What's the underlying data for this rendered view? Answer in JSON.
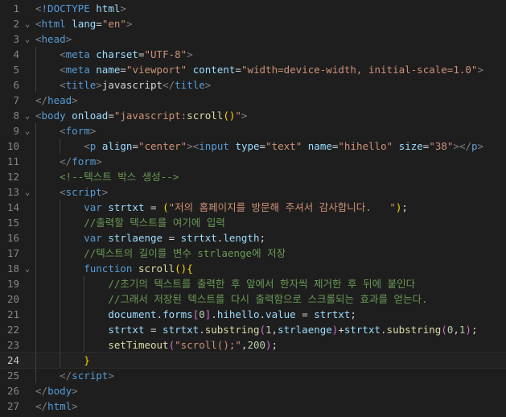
{
  "editor": {
    "theme": {
      "background": "#1e1e1e",
      "tag": "#569cd6",
      "attribute": "#9cdcfe",
      "string": "#ce9178",
      "comment": "#6a9955",
      "function": "#dcdcaa",
      "number": "#b5cea8"
    },
    "current_line": 24,
    "lines": [
      {
        "n": "1",
        "fold": "",
        "guides": 0,
        "tokens": [
          [
            "t-punct",
            "<"
          ],
          [
            "t-tag",
            "!DOCTYPE"
          ],
          [
            "t-txt",
            " "
          ],
          [
            "t-attr",
            "html"
          ],
          [
            "t-punct",
            ">"
          ]
        ]
      },
      {
        "n": "2",
        "fold": "⌄",
        "guides": 0,
        "tokens": [
          [
            "t-punct",
            "<"
          ],
          [
            "t-tag",
            "html"
          ],
          [
            "t-txt",
            " "
          ],
          [
            "t-attr",
            "lang"
          ],
          [
            "t-txt",
            "="
          ],
          [
            "t-str",
            "\"en\""
          ],
          [
            "t-punct",
            ">"
          ]
        ]
      },
      {
        "n": "3",
        "fold": "⌄",
        "guides": 0,
        "tokens": [
          [
            "t-punct",
            "<"
          ],
          [
            "t-tag",
            "head"
          ],
          [
            "t-punct",
            ">"
          ]
        ]
      },
      {
        "n": "4",
        "fold": "",
        "guides": 1,
        "tokens": [
          [
            "t-txt",
            "    "
          ],
          [
            "t-punct",
            "<"
          ],
          [
            "t-tag",
            "meta"
          ],
          [
            "t-txt",
            " "
          ],
          [
            "t-attr",
            "charset"
          ],
          [
            "t-txt",
            "="
          ],
          [
            "t-str",
            "\"UTF-8\""
          ],
          [
            "t-punct",
            ">"
          ]
        ]
      },
      {
        "n": "5",
        "fold": "",
        "guides": 1,
        "tokens": [
          [
            "t-txt",
            "    "
          ],
          [
            "t-punct",
            "<"
          ],
          [
            "t-tag",
            "meta"
          ],
          [
            "t-txt",
            " "
          ],
          [
            "t-attr",
            "name"
          ],
          [
            "t-txt",
            "="
          ],
          [
            "t-str",
            "\"viewport\""
          ],
          [
            "t-txt",
            " "
          ],
          [
            "t-attr",
            "content"
          ],
          [
            "t-txt",
            "="
          ],
          [
            "t-str",
            "\"width=device-width, initial-scale=1.0\""
          ],
          [
            "t-punct",
            ">"
          ]
        ]
      },
      {
        "n": "6",
        "fold": "",
        "guides": 1,
        "tokens": [
          [
            "t-txt",
            "    "
          ],
          [
            "t-punct",
            "<"
          ],
          [
            "t-tag",
            "title"
          ],
          [
            "t-punct",
            ">"
          ],
          [
            "t-txt",
            "javascript"
          ],
          [
            "t-punct",
            "</"
          ],
          [
            "t-tag",
            "title"
          ],
          [
            "t-punct",
            ">"
          ]
        ]
      },
      {
        "n": "7",
        "fold": "",
        "guides": 0,
        "tokens": [
          [
            "t-punct",
            "</"
          ],
          [
            "t-tag",
            "head"
          ],
          [
            "t-punct",
            ">"
          ]
        ]
      },
      {
        "n": "8",
        "fold": "⌄",
        "guides": 0,
        "tokens": [
          [
            "t-punct",
            "<"
          ],
          [
            "t-tag",
            "body"
          ],
          [
            "t-txt",
            " "
          ],
          [
            "t-attr",
            "onload"
          ],
          [
            "t-txt",
            "="
          ],
          [
            "t-str",
            "\"javascript:"
          ],
          [
            "t-fn",
            "scroll"
          ],
          [
            "t-br",
            "()"
          ],
          [
            "t-str",
            "\""
          ],
          [
            "t-punct",
            ">"
          ]
        ]
      },
      {
        "n": "9",
        "fold": "⌄",
        "guides": 1,
        "tokens": [
          [
            "t-txt",
            "    "
          ],
          [
            "t-punct",
            "<"
          ],
          [
            "t-tag",
            "form"
          ],
          [
            "t-punct",
            ">"
          ]
        ]
      },
      {
        "n": "10",
        "fold": "",
        "guides": 2,
        "tokens": [
          [
            "t-txt",
            "        "
          ],
          [
            "t-punct",
            "<"
          ],
          [
            "t-tag",
            "p"
          ],
          [
            "t-txt",
            " "
          ],
          [
            "t-attr",
            "align"
          ],
          [
            "t-txt",
            "="
          ],
          [
            "t-str",
            "\"center\""
          ],
          [
            "t-punct",
            "><"
          ],
          [
            "t-tag",
            "input"
          ],
          [
            "t-txt",
            " "
          ],
          [
            "t-attr",
            "type"
          ],
          [
            "t-txt",
            "="
          ],
          [
            "t-str",
            "\"text\""
          ],
          [
            "t-txt",
            " "
          ],
          [
            "t-attr",
            "name"
          ],
          [
            "t-txt",
            "="
          ],
          [
            "t-str",
            "\"hihello\""
          ],
          [
            "t-txt",
            " "
          ],
          [
            "t-attr",
            "size"
          ],
          [
            "t-txt",
            "="
          ],
          [
            "t-str",
            "\"38\""
          ],
          [
            "t-punct",
            "></"
          ],
          [
            "t-tag",
            "p"
          ],
          [
            "t-punct",
            ">"
          ]
        ]
      },
      {
        "n": "11",
        "fold": "",
        "guides": 1,
        "tokens": [
          [
            "t-txt",
            "    "
          ],
          [
            "t-punct",
            "</"
          ],
          [
            "t-tag",
            "form"
          ],
          [
            "t-punct",
            ">"
          ]
        ]
      },
      {
        "n": "12",
        "fold": "",
        "guides": 1,
        "tokens": [
          [
            "t-txt",
            "    "
          ],
          [
            "t-cmt",
            "<!--텍스트 박스 생성-->"
          ]
        ]
      },
      {
        "n": "13",
        "fold": "⌄",
        "guides": 1,
        "tokens": [
          [
            "t-txt",
            "    "
          ],
          [
            "t-punct",
            "<"
          ],
          [
            "t-tag",
            "script"
          ],
          [
            "t-punct",
            ">"
          ]
        ]
      },
      {
        "n": "14",
        "fold": "",
        "guides": 2,
        "tokens": [
          [
            "t-txt",
            "        "
          ],
          [
            "t-kw",
            "var"
          ],
          [
            "t-txt",
            " "
          ],
          [
            "t-attr",
            "strtxt"
          ],
          [
            "t-txt",
            " = "
          ],
          [
            "t-br",
            "("
          ],
          [
            "t-str",
            "\"저의 홈페이지를 방문해 주셔서 감사합니다.   \""
          ],
          [
            "t-br",
            ")"
          ],
          [
            "t-txt",
            ";"
          ]
        ]
      },
      {
        "n": "15",
        "fold": "",
        "guides": 2,
        "tokens": [
          [
            "t-txt",
            "        "
          ],
          [
            "t-cmt",
            "//출력할 텍스트를 여기에 입력"
          ]
        ]
      },
      {
        "n": "16",
        "fold": "",
        "guides": 2,
        "tokens": [
          [
            "t-txt",
            "        "
          ],
          [
            "t-kw",
            "var"
          ],
          [
            "t-txt",
            " "
          ],
          [
            "t-attr",
            "strlaenge"
          ],
          [
            "t-txt",
            " = "
          ],
          [
            "t-attr",
            "strtxt"
          ],
          [
            "t-txt",
            "."
          ],
          [
            "t-attr",
            "length"
          ],
          [
            "t-txt",
            ";"
          ]
        ]
      },
      {
        "n": "17",
        "fold": "",
        "guides": 2,
        "tokens": [
          [
            "t-txt",
            "        "
          ],
          [
            "t-cmt",
            "//텍스트의 길이를 변수 strlaenge에 저장"
          ]
        ]
      },
      {
        "n": "18",
        "fold": "⌄",
        "guides": 2,
        "tokens": [
          [
            "t-txt",
            "        "
          ],
          [
            "t-kw",
            "function"
          ],
          [
            "t-txt",
            " "
          ],
          [
            "t-fn",
            "scroll"
          ],
          [
            "t-br",
            "()"
          ],
          [
            "t-br",
            "{"
          ]
        ]
      },
      {
        "n": "19",
        "fold": "",
        "guides": 3,
        "tokens": [
          [
            "t-txt",
            "            "
          ],
          [
            "t-cmt",
            "//초기의 텍스트를 출력한 후 앞에서 한자씩 제거한 후 뒤에 붙인다"
          ]
        ]
      },
      {
        "n": "20",
        "fold": "",
        "guides": 3,
        "tokens": [
          [
            "t-txt",
            "            "
          ],
          [
            "t-cmt",
            "//그래서 저장된 텍스트를 다시 출력함으로 스크롤되는 효과를 얻는다."
          ]
        ]
      },
      {
        "n": "21",
        "fold": "",
        "guides": 3,
        "tokens": [
          [
            "t-txt",
            "            "
          ],
          [
            "t-attr",
            "document"
          ],
          [
            "t-txt",
            "."
          ],
          [
            "t-attr",
            "forms"
          ],
          [
            "t-br2",
            "["
          ],
          [
            "t-num",
            "0"
          ],
          [
            "t-br2",
            "]"
          ],
          [
            "t-txt",
            "."
          ],
          [
            "t-attr",
            "hihello"
          ],
          [
            "t-txt",
            "."
          ],
          [
            "t-attr",
            "value"
          ],
          [
            "t-txt",
            " = "
          ],
          [
            "t-attr",
            "strtxt"
          ],
          [
            "t-txt",
            ";"
          ]
        ]
      },
      {
        "n": "22",
        "fold": "",
        "guides": 3,
        "tokens": [
          [
            "t-txt",
            "            "
          ],
          [
            "t-attr",
            "strtxt"
          ],
          [
            "t-txt",
            " = "
          ],
          [
            "t-attr",
            "strtxt"
          ],
          [
            "t-txt",
            "."
          ],
          [
            "t-fn",
            "substring"
          ],
          [
            "t-br2",
            "("
          ],
          [
            "t-num",
            "1"
          ],
          [
            "t-txt",
            ","
          ],
          [
            "t-attr",
            "strlaenge"
          ],
          [
            "t-br2",
            ")"
          ],
          [
            "t-txt",
            "+"
          ],
          [
            "t-attr",
            "strtxt"
          ],
          [
            "t-txt",
            "."
          ],
          [
            "t-fn",
            "substring"
          ],
          [
            "t-br2",
            "("
          ],
          [
            "t-num",
            "0"
          ],
          [
            "t-txt",
            ","
          ],
          [
            "t-num",
            "1"
          ],
          [
            "t-br2",
            ")"
          ],
          [
            "t-txt",
            ";"
          ]
        ]
      },
      {
        "n": "23",
        "fold": "",
        "guides": 3,
        "tokens": [
          [
            "t-txt",
            "            "
          ],
          [
            "t-fn",
            "setTimeout"
          ],
          [
            "t-br2",
            "("
          ],
          [
            "t-str",
            "\"scroll();\""
          ],
          [
            "t-txt",
            ","
          ],
          [
            "t-num",
            "200"
          ],
          [
            "t-br2",
            ")"
          ],
          [
            "t-txt",
            ";"
          ]
        ]
      },
      {
        "n": "24",
        "fold": "",
        "guides": 2,
        "tokens": [
          [
            "t-txt",
            "        "
          ],
          [
            "t-br",
            "}"
          ]
        ]
      },
      {
        "n": "25",
        "fold": "",
        "guides": 1,
        "tokens": [
          [
            "t-txt",
            "    "
          ],
          [
            "t-punct",
            "</"
          ],
          [
            "t-tag",
            "script"
          ],
          [
            "t-punct",
            ">"
          ]
        ]
      },
      {
        "n": "26",
        "fold": "",
        "guides": 0,
        "tokens": [
          [
            "t-punct",
            "</"
          ],
          [
            "t-tag",
            "body"
          ],
          [
            "t-punct",
            ">"
          ]
        ]
      },
      {
        "n": "27",
        "fold": "",
        "guides": 0,
        "tokens": [
          [
            "t-punct",
            "</"
          ],
          [
            "t-tag",
            "html"
          ],
          [
            "t-punct",
            ">"
          ]
        ]
      }
    ]
  }
}
